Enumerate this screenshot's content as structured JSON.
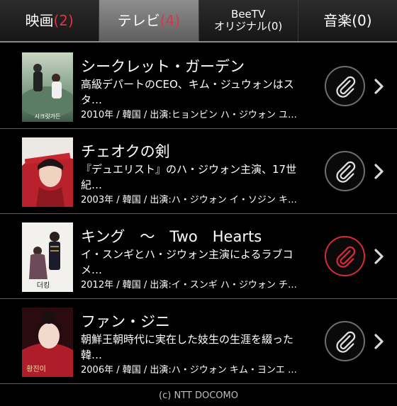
{
  "tabs": [
    {
      "label": "映画",
      "count": "(2)"
    },
    {
      "label": "テレビ",
      "count": "(4)"
    },
    {
      "line1": "BeeTV",
      "line2": "オリジナル(0)"
    },
    {
      "label": "音楽(0)"
    }
  ],
  "items": [
    {
      "title": "シークレット・ガーデン",
      "desc": "高級デパートのCEO、キム・ジュウォンはスタ…",
      "meta": "2010年 / 韓国 / 出演:ヒョンビン ハ・ジウォン ユ…",
      "poster_text": "시크릿가든"
    },
    {
      "title": "チェオクの剣",
      "desc": "『デュエリスト』のハ・ジウォン主演、17世紀…",
      "meta": "2003年 / 韓国 / 出演:ハ・ジウォン イ・ソジン キ…"
    },
    {
      "title": "キング　～　Two　Hearts",
      "desc": "イ・スンギとハ・ジウォン主演によるラブコメ…",
      "meta": "2012年 / 韓国 / 出演:イ・スンギ ハ・ジウォン チ…",
      "poster_text": "더킹"
    },
    {
      "title": "ファン・ジニ",
      "desc": "朝鮮王朝時代に実在した妓生の生涯を綴った韓…",
      "meta": "2006年 / 韓国 / 出演:ハ・ジウォン キム・ヨンエ …",
      "poster_text": "황진이"
    }
  ],
  "footer": "(c) NTT DOCOMO",
  "colors": {
    "accent": "#e0314a",
    "clip_active": "#d8283c"
  }
}
